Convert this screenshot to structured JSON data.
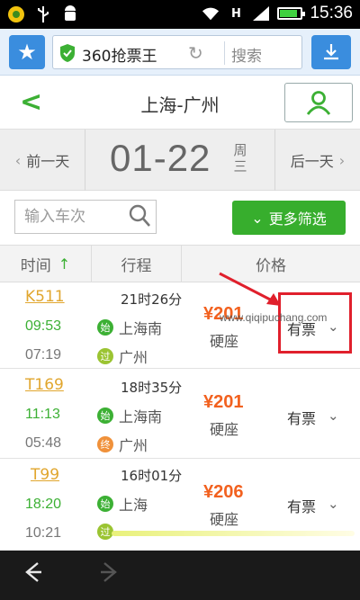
{
  "status_bar": {
    "time": "15:36",
    "icons": [
      "notification-icon",
      "usb-icon",
      "android-icon",
      "wifi-icon",
      "sim-h-icon",
      "signal-icon",
      "battery-icon"
    ],
    "battery_level": 0.85
  },
  "browser": {
    "url_label": "360抢票王",
    "search_placeholder": "搜索",
    "accent_color": "#3a8dde"
  },
  "header": {
    "title": "上海-广州",
    "back_glyph": "<",
    "accent_color": "#3cb034"
  },
  "date_bar": {
    "prev_label": "前一天",
    "date": "01-22",
    "weekday_top": "周",
    "weekday_bottom": "三",
    "next_label": "后一天"
  },
  "filter": {
    "train_input_placeholder": "输入车次",
    "more_filters_label": "更多筛选"
  },
  "table": {
    "columns": [
      "时间",
      "行程",
      "价格"
    ],
    "sort_indicator": "↑"
  },
  "trains": [
    {
      "number": "K511",
      "depart": "09:53",
      "arrive": "07:19",
      "duration": "21时26分",
      "from": "上海南",
      "from_badge": "始",
      "to": "广州",
      "to_badge": "过",
      "price": "¥201",
      "seat": "硬座",
      "availability": "有票"
    },
    {
      "number": "T169",
      "depart": "11:13",
      "arrive": "05:48",
      "duration": "18时35分",
      "from": "上海南",
      "from_badge": "始",
      "to": "广州",
      "to_badge": "终",
      "price": "¥201",
      "seat": "硬座",
      "availability": "有票"
    },
    {
      "number": "T99",
      "depart": "18:20",
      "arrive": "10:21",
      "duration": "16时01分",
      "from": "上海",
      "from_badge": "始",
      "to": "",
      "to_badge": "过",
      "price": "¥206",
      "seat": "硬座",
      "availability": "有票"
    }
  ],
  "watermark": "www.qiqipuchang.com",
  "colors": {
    "green": "#3cb034",
    "price_orange": "#f2611f",
    "train_number": "#e1a62e",
    "highlight_red": "#e0202c"
  }
}
